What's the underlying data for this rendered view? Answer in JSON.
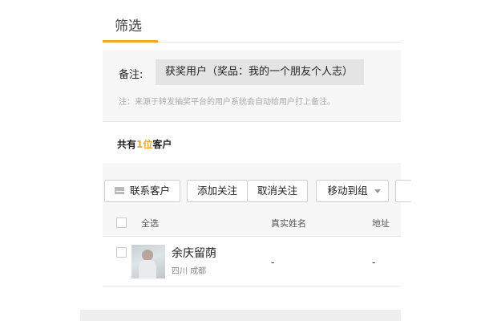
{
  "tabs": {
    "filter_label": "筛选"
  },
  "remark": {
    "label": "备注:",
    "value": "获奖用户（奖品：我的一个朋友个人志）",
    "note": "注：来源于转发抽奖平台的用户系统会自动给用户打上备注。"
  },
  "summary": {
    "prefix": "共有",
    "count": "1位",
    "suffix": "客户"
  },
  "toolbar": {
    "contact_label": "联系客户",
    "follow_label": "添加关注",
    "unfollow_label": "取消关注",
    "move_label": "移动到组"
  },
  "table": {
    "select_all_label": "全选",
    "columns": {
      "real_name": "真实姓名",
      "address": "地址"
    },
    "rows": [
      {
        "nickname": "余庆留荫",
        "location": "四川 成都",
        "real_name": "-",
        "address": "-"
      }
    ]
  },
  "colors": {
    "accent": "#f3a722",
    "panel_bg": "#f7f7f7"
  },
  "icons": {
    "contact": "mail-icon",
    "move": "chevron-down-icon"
  }
}
